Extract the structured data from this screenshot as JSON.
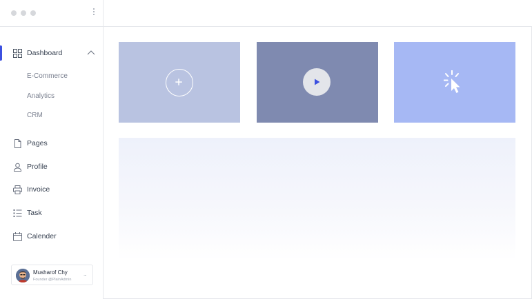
{
  "sidebar": {
    "nav": {
      "dashboard": "Dashboard",
      "pages": "Pages",
      "profile": "Profile",
      "invoice": "Invoice",
      "task": "Task",
      "calender": "Calender"
    },
    "dashboard_sub": [
      "E-Commerce",
      "Analytics",
      "CRM"
    ],
    "user": {
      "name": "Musharof Chy",
      "role": "Founder @PlainAdmin",
      "more": "..."
    }
  },
  "colors": {
    "accent": "#3c50e0",
    "card1": "#b9c3e1",
    "card2": "#7f8ab0",
    "card3": "#a6b8f4"
  },
  "icons": {
    "card1": "plus-circle-icon",
    "card2": "play-icon",
    "card3": "cursor-click-icon"
  }
}
